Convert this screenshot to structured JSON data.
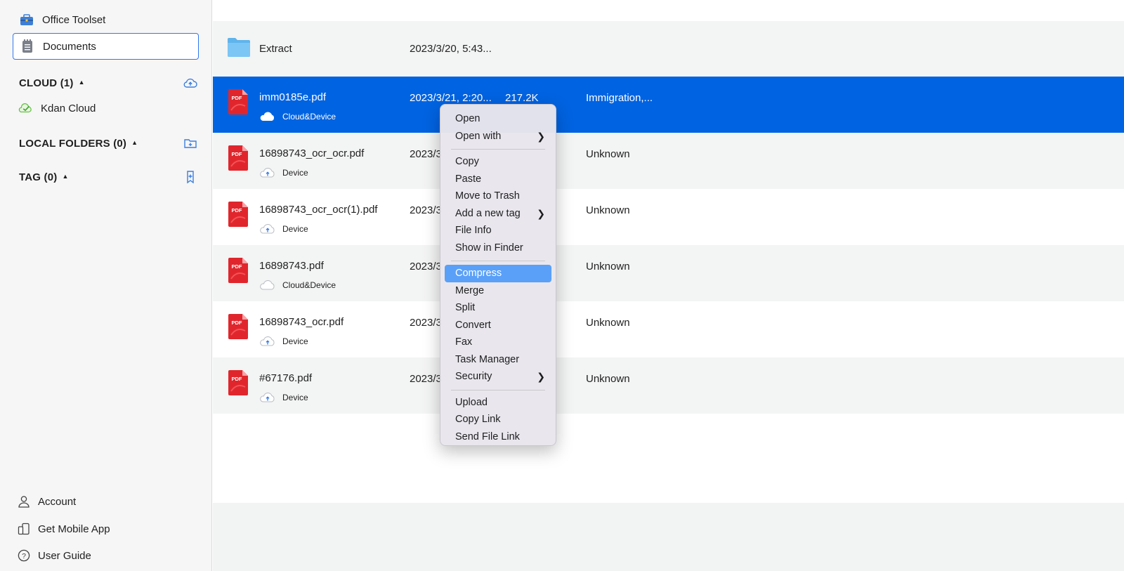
{
  "sidebar": {
    "office_toolset": "Office Toolset",
    "documents": "Documents",
    "cloud": {
      "label": "CLOUD (1)",
      "items": [
        "Kdan Cloud"
      ]
    },
    "local_folders": {
      "label": "LOCAL FOLDERS (0)"
    },
    "tag": {
      "label": "TAG (0)"
    },
    "bottom": {
      "account": "Account",
      "mobile": "Get Mobile App",
      "guide": "User Guide"
    }
  },
  "files": [
    {
      "name": "Extract",
      "date": "2023/3/20, 5:43...",
      "size": "",
      "tag": "",
      "location": "",
      "type": "folder"
    },
    {
      "name": "imm0185e.pdf",
      "date": "2023/3/21, 2:20...",
      "size": "217.2K",
      "tag": "Immigration,...",
      "location": "Cloud&Device",
      "type": "pdf",
      "selected": true
    },
    {
      "name": "16898743_ocr_ocr.pdf",
      "date": "2023/3",
      "size": "",
      "tag": "Unknown",
      "location": "Device",
      "type": "pdf"
    },
    {
      "name": "16898743_ocr_ocr(1).pdf",
      "date": "2023/3",
      "size": "",
      "tag": "Unknown",
      "location": "Device",
      "type": "pdf"
    },
    {
      "name": "16898743.pdf",
      "date": "2023/3",
      "size": "",
      "tag": "Unknown",
      "location": "Cloud&Device",
      "type": "pdf"
    },
    {
      "name": "16898743_ocr.pdf",
      "date": "2023/3",
      "size": "",
      "tag": "Unknown",
      "location": "Device",
      "type": "pdf"
    },
    {
      "name": "#67176.pdf",
      "date": "2023/3",
      "size": "",
      "tag": "Unknown",
      "location": "Device",
      "type": "pdf"
    }
  ],
  "pdf_badge": "PDF",
  "context_menu": {
    "open": "Open",
    "open_with": "Open with",
    "copy": "Copy",
    "paste": "Paste",
    "move_to_trash": "Move to Trash",
    "add_tag": "Add a new tag",
    "file_info": "File Info",
    "show_in_finder": "Show in Finder",
    "compress": "Compress",
    "merge": "Merge",
    "split": "Split",
    "convert": "Convert",
    "fax": "Fax",
    "task_manager": "Task Manager",
    "security": "Security",
    "upload": "Upload",
    "copy_link": "Copy Link",
    "send_file_link": "Send File Link",
    "highlighted": "Compress"
  },
  "colors": {
    "selection": "#0063e1",
    "accent": "#2f78f0",
    "menu_highlight": "#5aa0f8",
    "pdf_red": "#e0262c"
  }
}
